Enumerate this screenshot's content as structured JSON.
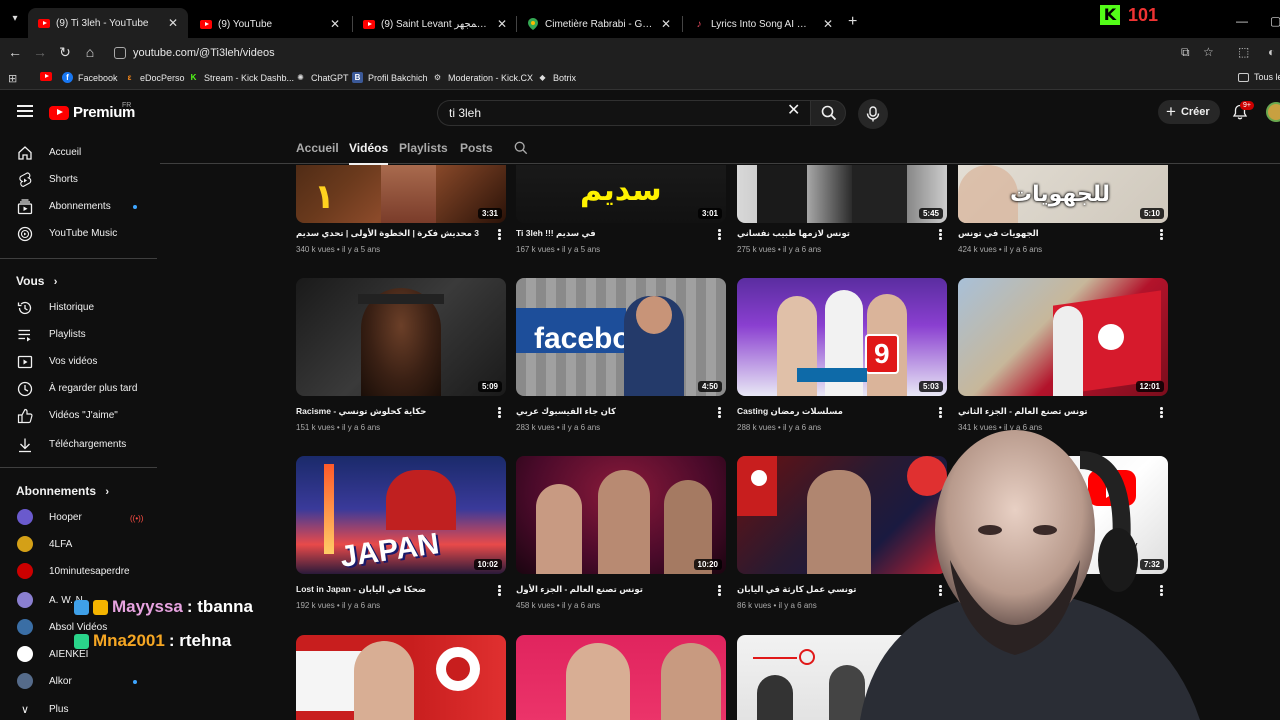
{
  "browser": {
    "tabs": [
      {
        "title": "(9) Ti 3leh - YouTube",
        "icon": "youtube-icon",
        "active": true
      },
      {
        "title": "(9) YouTube",
        "icon": "youtube-icon",
        "active": false
      },
      {
        "title": "(9) Saint Levant تحت المجهر | Kl...",
        "icon": "youtube-icon",
        "active": false
      },
      {
        "title": "Cimetière Rabrabi - Google Ma...",
        "icon": "map-pin-icon",
        "active": false
      },
      {
        "title": "Lyrics Into Song AI Music Detai...",
        "icon": "music-note-icon",
        "active": false
      }
    ],
    "url": "youtube.com/@Ti3leh/videos",
    "bookmarks": [
      {
        "label": "",
        "icon": "youtube-icon"
      },
      {
        "label": "Facebook",
        "icon": "facebook-icon"
      },
      {
        "label": "eDocPerso",
        "icon": "edocperso-icon"
      },
      {
        "label": "Stream - Kick Dashb...",
        "icon": "kick-icon"
      },
      {
        "label": "ChatGPT",
        "icon": "chatgpt-icon"
      },
      {
        "label": "Profil Bakchich",
        "icon": "bakchich-icon"
      },
      {
        "label": "Moderation - Kick.CX",
        "icon": "gear-icon"
      },
      {
        "label": "Botrix",
        "icon": "botrix-icon"
      }
    ],
    "bookmarks_all": "Tous le"
  },
  "kick_overlay": {
    "logo": "K",
    "viewers": "101"
  },
  "youtube": {
    "logo_text": "Premium",
    "region": "FR",
    "search_value": "ti 3leh",
    "create_label": "Créer",
    "notif_count": "9+"
  },
  "sidebar": {
    "main": [
      {
        "label": "Accueil",
        "icon": "home-icon"
      },
      {
        "label": "Shorts",
        "icon": "shorts-icon"
      },
      {
        "label": "Abonnements",
        "icon": "subscriptions-icon"
      },
      {
        "label": "YouTube Music",
        "icon": "youtube-music-icon"
      }
    ],
    "you_section": "Vous",
    "you": [
      {
        "label": "Historique",
        "icon": "history-icon"
      },
      {
        "label": "Playlists",
        "icon": "playlists-icon"
      },
      {
        "label": "Vos vidéos",
        "icon": "your-videos-icon"
      },
      {
        "label": "À regarder plus tard",
        "icon": "watch-later-icon"
      },
      {
        "label": "Vidéos \"J'aime\"",
        "icon": "like-icon"
      },
      {
        "label": "Téléchargements",
        "icon": "download-icon"
      }
    ],
    "subs_section": "Abonnements",
    "subscriptions": [
      {
        "label": "Hooper",
        "color": "#6a5acd"
      },
      {
        "label": "4LFA",
        "color": "#d4a017"
      },
      {
        "label": "10minutesaperdre",
        "color": "#cc0000"
      },
      {
        "label": "A. W. N",
        "color": "#8a7fd0"
      },
      {
        "label": "Absol Vidéos",
        "color": "#3a6ea5"
      },
      {
        "label": "AIENKEI",
        "color": "#ffffff"
      },
      {
        "label": "Alkor",
        "color": "#556b8a"
      }
    ],
    "more_label": "Plus"
  },
  "channel_tabs": [
    "Accueil",
    "Vidéos",
    "Playlists",
    "Posts"
  ],
  "videos": [
    {
      "title": "3 محديش فكرة | الخطوة الأولى | تحدي سديم",
      "meta": "340 k vues • il y a 5 ans",
      "duration": "3:31",
      "thumb_text": "١"
    },
    {
      "title": "Ti 3leh !!! في سديم",
      "meta": "167 k vues • il y a 5 ans",
      "duration": "3:01",
      "thumb_text": "سديم"
    },
    {
      "title": "تونس لازمها طبيب نفساني",
      "meta": "275 k vues • il y a 6 ans",
      "duration": "5:45",
      "thumb_text": ""
    },
    {
      "title": "الجهويات في تونس",
      "meta": "424 k vues • il y a 6 ans",
      "duration": "5:10",
      "thumb_text": "للجهويات"
    },
    {
      "title": "Racisme - حكاية كحلوش تونسي",
      "meta": "151 k vues • il y a 6 ans",
      "duration": "5:09",
      "thumb_text": ""
    },
    {
      "title": "كان جاء الفيسبوك عربي",
      "meta": "283 k vues • il y a 6 ans",
      "duration": "4:50",
      "thumb_text": "facebo"
    },
    {
      "title": "Casting مسلسلات رمضان",
      "meta": "288 k vues • il y a 6 ans",
      "duration": "5:03",
      "thumb_text": "9"
    },
    {
      "title": "تونس تصنع العالم - الجزء الثاني",
      "meta": "341 k vues • il y a 6 ans",
      "duration": "12:01",
      "thumb_text": ""
    },
    {
      "title": "Lost in Japan - ضحكا في اليابان",
      "meta": "192 k vues • il y a 6 ans",
      "duration": "10:02",
      "thumb_text": "JAPAN"
    },
    {
      "title": "تونس تصنع العالم - الجزء الأول",
      "meta": "458 k vues • il y a 6 ans",
      "duration": "10:20",
      "thumb_text": ""
    },
    {
      "title": "تونسي عمل كارثة في اليابان",
      "meta": "86 k vues • il y a 6 ans",
      "duration": "",
      "thumb_text": ""
    },
    {
      "title": "",
      "meta": "",
      "duration": "7:32",
      "thumb_text": "Ny"
    },
    {
      "title": "",
      "meta": "",
      "duration": "",
      "thumb_text": ""
    },
    {
      "title": "",
      "meta": "",
      "duration": "",
      "thumb_text": ""
    },
    {
      "title": "",
      "meta": "",
      "duration": "",
      "thumb_text": ""
    }
  ],
  "chat": [
    {
      "user": "Mayyssa",
      "message": ": tbanna"
    },
    {
      "user": "Mna2001",
      "message": ": rtehna"
    }
  ]
}
